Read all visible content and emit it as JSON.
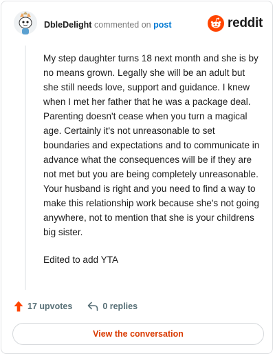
{
  "header": {
    "username": "DbleDelight",
    "action_text": "commented on",
    "post_link": "post",
    "brand": "reddit"
  },
  "comment": {
    "paragraphs": [
      "My step daughter turns 18 next month and she is by no means grown. Legally she will be an adult but she still needs love, support and guidance. I knew when I met her father that he was a package deal. Parenting doesn't cease when you turn a magical age. Certainly it's not unreasonable to set boundaries and expectations and to communicate in advance what the consequences will be if they are not met but you are being completely unreasonable. Your husband is right and you need to find a way to make this relationship work because she's not going anywhere, not to mention that she is your childrens big sister.",
      "Edited to add YTA"
    ]
  },
  "actions": {
    "upvotes": "17 upvotes",
    "replies": "0 replies"
  },
  "cta": {
    "label": "View the conversation"
  },
  "colors": {
    "brand_orange": "#ff4500",
    "link_blue": "#0079d3",
    "cta_text": "#d93a00",
    "muted_text": "#576f76"
  },
  "icons": [
    "avatar-icon",
    "reddit-logo-icon",
    "upvote-arrow-icon",
    "reply-arrow-icon"
  ]
}
